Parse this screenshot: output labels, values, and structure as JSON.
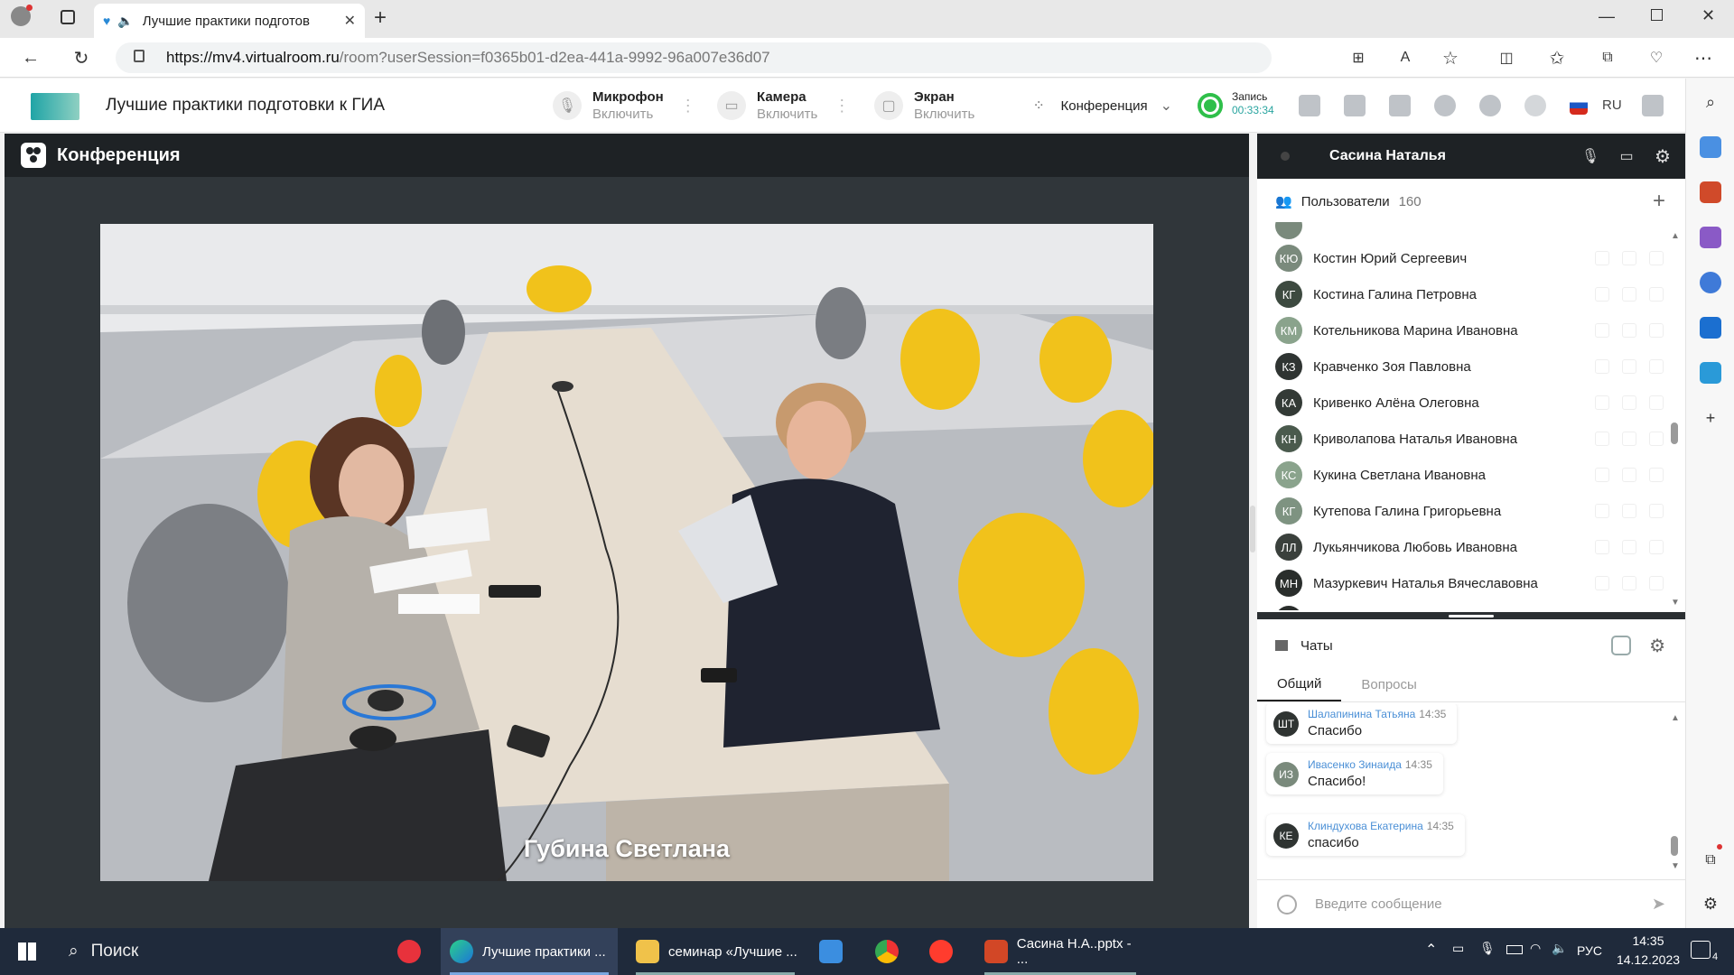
{
  "browser": {
    "tab_title": "Лучшие практики подготов",
    "url_host": "https://mv4.virtualroom.ru",
    "url_rest": "/room?userSession=f0365b01-d2ea-441a-9992-96a007e36d07"
  },
  "header": {
    "room_title": "Лучшие практики подготовки к ГИА",
    "mic": {
      "title": "Микрофон",
      "action": "Включить"
    },
    "camera": {
      "title": "Камера",
      "action": "Включить"
    },
    "screen": {
      "title": "Экран",
      "action": "Включить"
    },
    "mode": "Конференция",
    "record_label": "Запись",
    "record_time": "00:33:34",
    "language": "RU"
  },
  "stage": {
    "title": "Конференция",
    "speaker_name": "Губина Светлана"
  },
  "panel": {
    "current_user": "Сасина Наталья",
    "users_label": "Пользователи",
    "users_count": "160",
    "users": [
      {
        "initials": "КЮ",
        "name": "Костин Юрий Сергеевич",
        "color": "#7a8a7c"
      },
      {
        "initials": "КГ",
        "name": "Костина Галина Петровна",
        "color": "#3d4a40"
      },
      {
        "initials": "КМ",
        "name": "Котельникова Марина Ивановна",
        "color": "#8aa38c"
      },
      {
        "initials": "КЗ",
        "name": "Кравченко Зоя Павловна",
        "color": "#2f3432"
      },
      {
        "initials": "КА",
        "name": "Кривенко Алёна Олеговна",
        "color": "#333a36"
      },
      {
        "initials": "КН",
        "name": "Криволапова Наталья Ивановна",
        "color": "#4a5a4d"
      },
      {
        "initials": "КС",
        "name": "Кукина Светлана Ивановна",
        "color": "#8aa38c"
      },
      {
        "initials": "КГ",
        "name": "Кутепова Галина Григорьевна",
        "color": "#7e9381"
      },
      {
        "initials": "ЛЛ",
        "name": "Лукьянчикова Любовь Ивановна",
        "color": "#3a403c"
      },
      {
        "initials": "МН",
        "name": "Мазуркевич Наталья Вячеславовна",
        "color": "#2a2e2c"
      }
    ],
    "chats_label": "Чаты",
    "tab_general": "Общий",
    "tab_questions": "Вопросы",
    "messages": [
      {
        "initials": "ШТ",
        "author": "Шалапинина Татьяна",
        "time": "14:35",
        "text": "Спасибо",
        "color": "#2f3432"
      },
      {
        "initials": "ИЗ",
        "author": "Ивасенко Зинаида",
        "time": "14:35",
        "text": "Спасибо!",
        "color": "#7a8a7c"
      },
      {
        "initials": "КЕ",
        "author": "Клиндухова Екатерина",
        "time": "14:35",
        "text": "спасибо",
        "color": "#2f3432"
      }
    ],
    "compose_placeholder": "Введите сообщение"
  },
  "taskbar": {
    "search": "Поиск",
    "apps": [
      {
        "label": "Лучшие практики ..."
      },
      {
        "label": "семинар «Лучшие ..."
      },
      {
        "label": "Сасина Н.А..pptx - ..."
      }
    ],
    "lang": "РУС",
    "time": "14:35",
    "date": "14.12.2023",
    "notif": "4"
  }
}
